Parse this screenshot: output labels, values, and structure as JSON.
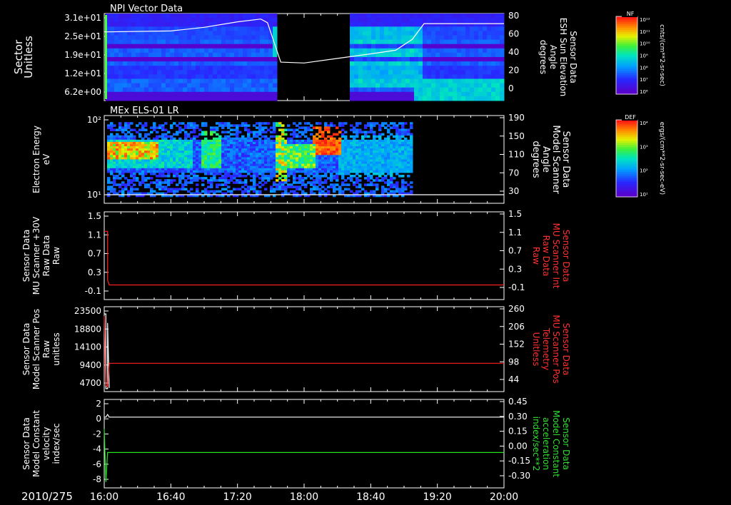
{
  "date_label": "2010/275",
  "time_axis": {
    "start": "16:00",
    "end": "20:00",
    "ticks": [
      "16:00",
      "16:40",
      "17:20",
      "18:00",
      "18:40",
      "19:20",
      "20:00"
    ]
  },
  "colorbars": [
    {
      "label": "NF",
      "units": "cnts/(cm**2-sr-sec)",
      "tick_labels": [
        "10¹²",
        "10¹¹",
        "10¹⁰",
        "10⁹",
        "10⁸",
        "10⁷",
        "10⁶"
      ]
    },
    {
      "label": "DEF",
      "units": "ergs/(cm**2-sr-sec-eV)",
      "tick_labels": [
        "10⁴",
        "10³",
        "10²",
        "10¹"
      ]
    }
  ],
  "chart_data": [
    {
      "type": "heatmap",
      "title": "NPI Vector Data",
      "ylabel": [
        "Sector",
        "Unitless"
      ],
      "yticks": [
        "3.1e+01",
        "2.5e+01",
        "1.9e+01",
        "1.2e+01",
        "6.2e+00"
      ],
      "y2label": [
        "Sensor Data",
        "ESH Sun Elevation",
        "Angle",
        "degrees"
      ],
      "y2ticks": [
        "80",
        "60",
        "40",
        "20",
        "0"
      ],
      "y2lim": [
        -15,
        80
      ],
      "data_gaps": [
        [
          "17:46",
          "18:27"
        ]
      ],
      "overlay_series": {
        "name": "ESH Sun Elevation Angle",
        "color": "#ffffff",
        "x": [
          "16:00",
          "16:02",
          "16:40",
          "17:00",
          "17:20",
          "17:34",
          "17:38",
          "17:46",
          "18:00",
          "18:20",
          "18:40",
          "18:55",
          "19:05",
          "19:12",
          "20:00"
        ],
        "y": [
          60,
          60,
          61,
          65,
          71,
          74,
          70,
          27,
          26,
          31,
          36,
          40,
          52,
          69,
          69
        ]
      }
    },
    {
      "type": "heatmap",
      "title": "MEx ELS-01 LR",
      "ylabel": [
        "Electron Energy",
        "eV"
      ],
      "yticks": [
        "10²",
        "10¹"
      ],
      "y2label": [
        "Sensor Data",
        "Model Scanner",
        "Angle",
        "degrees"
      ],
      "y2ticks": [
        "190",
        "150",
        "110",
        "70",
        "30"
      ],
      "data_end": "19:05",
      "overlay_series": {
        "name": "Model Scanner Angle",
        "color": "#ffffff",
        "x": [
          "16:01",
          "20:00"
        ],
        "y": [
          10,
          10
        ]
      }
    },
    {
      "type": "line",
      "ylabel": [
        "Sensor Data",
        "MU Scanner +30V",
        "Raw Data",
        "Raw"
      ],
      "yticks": [
        "1.5",
        "1.1",
        "0.7",
        "0.3",
        "-0.1"
      ],
      "ylim": [
        -0.3,
        1.5
      ],
      "y2label": [
        "Sensor Data",
        "MU Scanner Int",
        "Raw Data",
        "Raw"
      ],
      "y2ticks": [
        "1.5",
        "1.1",
        "0.7",
        "0.3",
        "-0.1"
      ],
      "series": [
        {
          "name": "MU Scanner Int Raw Data",
          "color": "#ff2020",
          "x": [
            "16:00",
            "16:01",
            "16:02",
            "16:02",
            "16:03",
            "20:00"
          ],
          "y": [
            1.1,
            1.1,
            1.1,
            0.1,
            0.0,
            0.0
          ]
        }
      ]
    },
    {
      "type": "line",
      "ylabel": [
        "Sensor Data",
        "Model Scanner Pos",
        "Raw",
        "unitless"
      ],
      "yticks": [
        "23500",
        "18800",
        "14100",
        "9400",
        "4700"
      ],
      "ylim": [
        0,
        23500
      ],
      "y2label": [
        "Sensor Data",
        "MU Scanner Pos",
        "Telemetry",
        "Unitless"
      ],
      "y2ticks": [
        "260",
        "206",
        "152",
        "98",
        "44"
      ],
      "y2lim": [
        -10,
        260
      ],
      "series": [
        {
          "name": "Model Scanner Pos",
          "color": "#ffffff",
          "x": [
            "16:00",
            "16:01",
            "16:01",
            "16:02",
            "16:02",
            "16:03"
          ],
          "y": [
            21500,
            21500,
            800,
            800,
            19000,
            1000
          ]
        },
        {
          "name": "MU Scanner Pos Telemetry",
          "color": "#ff2020",
          "x": [
            "16:00",
            "16:01",
            "16:02",
            "16:03",
            "16:04",
            "20:00"
          ],
          "y": [
            230,
            10,
            5,
            80,
            80,
            80
          ]
        }
      ]
    },
    {
      "type": "line",
      "ylabel": [
        "Sensor Data",
        "Model Constant",
        "velocity",
        "index/sec"
      ],
      "yticks": [
        "2",
        "0",
        "-2",
        "-4",
        "-6",
        "-8"
      ],
      "ylim": [
        -8,
        2
      ],
      "y2label": [
        "Sensor Data",
        "Model Constant",
        "acceleration",
        "index/sec**2"
      ],
      "y2ticks": [
        "0.45",
        "0.30",
        "0.15",
        "0.00",
        "-0.15",
        "-0.30"
      ],
      "y2lim": [
        -0.3,
        0.45
      ],
      "series": [
        {
          "name": "Model Constant velocity",
          "color": "#ffffff",
          "x": [
            "16:00",
            "16:01",
            "16:02",
            "16:03",
            "20:00"
          ],
          "y": [
            0,
            0,
            0.3,
            0,
            0
          ]
        },
        {
          "name": "Model Constant acceleration",
          "color": "#20e020",
          "x": [
            "16:00",
            "16:01",
            "16:02",
            "16:03",
            "20:00"
          ],
          "y": [
            0.2,
            -0.25,
            0.0,
            0.0,
            0.0
          ]
        }
      ]
    }
  ]
}
